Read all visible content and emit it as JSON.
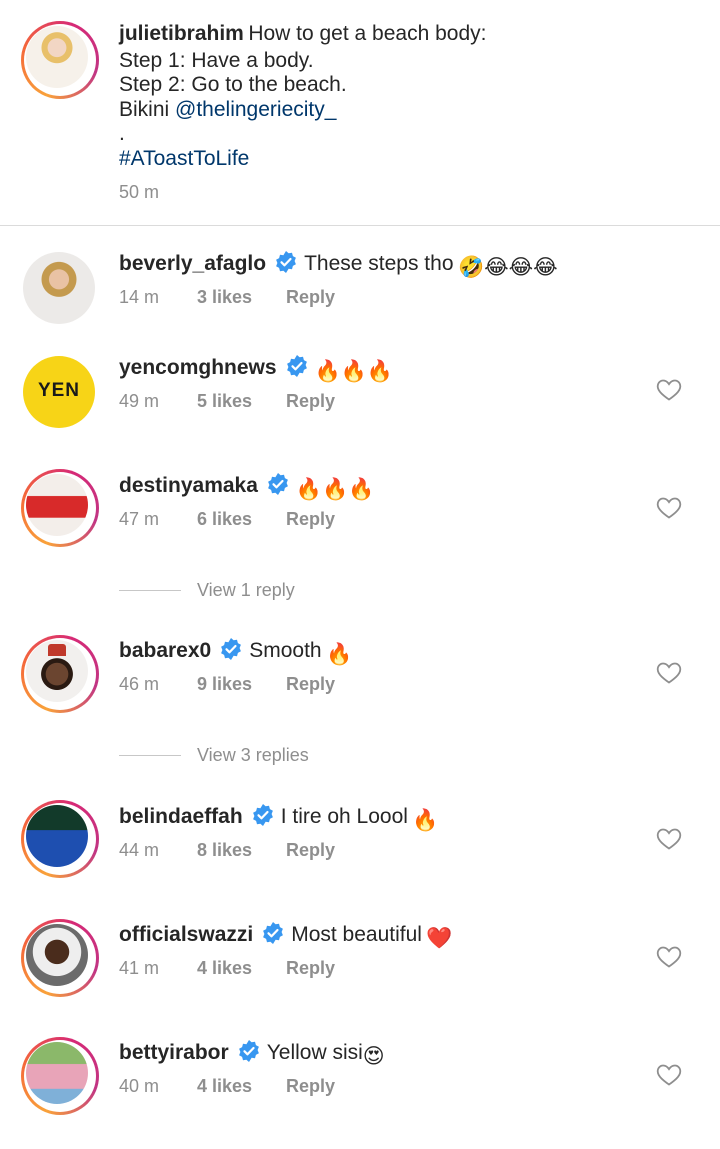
{
  "caption": {
    "username": "julietibrahim",
    "line1": "How to get a beach body:",
    "line2": "Step 1: Have a body.",
    "line3": "Step 2: Go to the beach.",
    "line4_prefix": "Bikini",
    "mention": "@thelingeriecity_",
    "dot": ".",
    "hashtag": "#AToastToLife",
    "time": "50 m"
  },
  "comments": [
    {
      "username": "beverly_afaglo",
      "text": "These steps tho",
      "emojis": "🤣😂😂😂",
      "time": "14 m",
      "likes": "3 likes",
      "reply": "Reply"
    },
    {
      "username": "yencomghnews",
      "text": "",
      "emojis": "🔥🔥🔥",
      "time": "49 m",
      "likes": "5 likes",
      "reply": "Reply",
      "avatar_text": "YEN"
    },
    {
      "username": "destinyamaka",
      "text": "",
      "emojis": "🔥🔥🔥",
      "time": "47 m",
      "likes": "6 likes",
      "reply": "Reply"
    },
    {
      "username": "babarex0",
      "text": "Smooth",
      "emojis": "🔥",
      "time": "46 m",
      "likes": "9 likes",
      "reply": "Reply"
    },
    {
      "username": "belindaeffah",
      "text": "I tire oh Loool",
      "emojis": "🔥",
      "time": "44 m",
      "likes": "8 likes",
      "reply": "Reply"
    },
    {
      "username": "officialswazzi",
      "text": "Most beautiful",
      "emojis": "❤️",
      "time": "41 m",
      "likes": "4 likes",
      "reply": "Reply"
    },
    {
      "username": "bettyirabor",
      "text": "Yellow sisi",
      "emojis": "😍",
      "time": "40 m",
      "likes": "4 likes",
      "reply": "Reply"
    }
  ],
  "view_replies": [
    "View 1 reply",
    "View 3 replies"
  ],
  "colors": {
    "link": "#00376b",
    "verified": "#3897f0",
    "meta": "#8e8e8e",
    "heart_outline": "#8e8e8e"
  }
}
